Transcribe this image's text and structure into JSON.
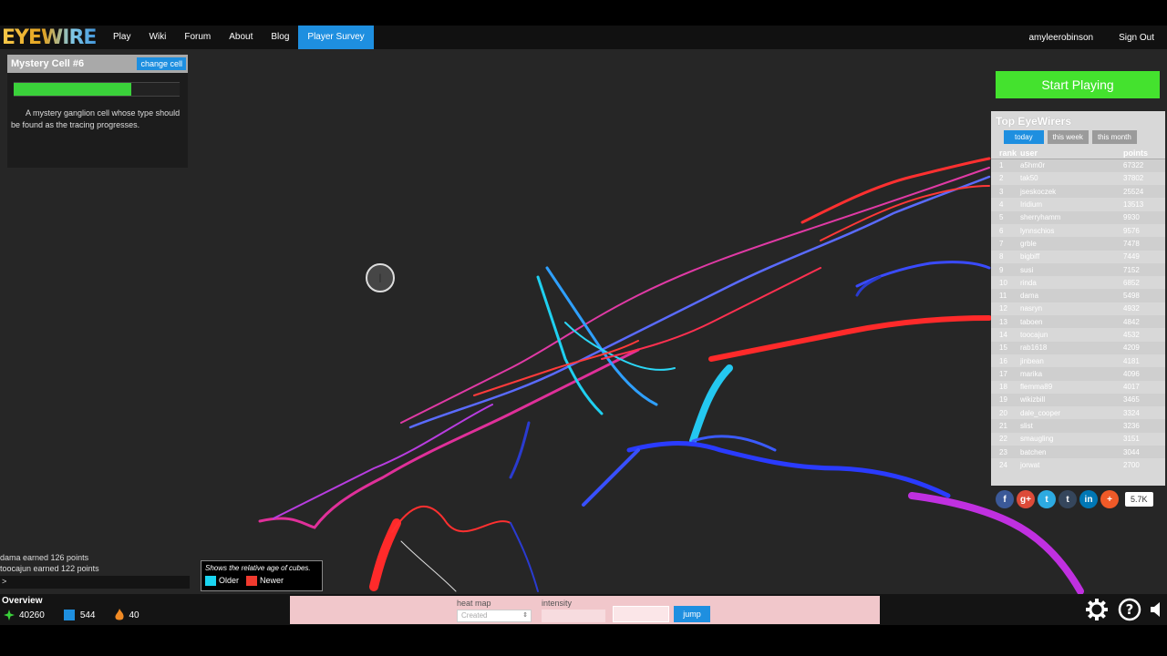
{
  "nav": {
    "logo": "EYEWIRE",
    "items": [
      "Play",
      "Wiki",
      "Forum",
      "About",
      "Blog",
      "Player Survey"
    ],
    "active_index": 5,
    "username": "amyleerobinson",
    "signout": "Sign Out"
  },
  "cell": {
    "title": "Mystery Cell #6",
    "change_label": "change cell",
    "progress_percent": 71,
    "description": "A mystery ganglion cell whose type should be found as the tracing progresses."
  },
  "start_label": "Start Playing",
  "leaderboard": {
    "title": "Top EyeWirers",
    "tabs": [
      "today",
      "this week",
      "this month"
    ],
    "active_tab": 0,
    "headers": [
      "rank",
      "user",
      "points"
    ],
    "rows": [
      {
        "rank": "1",
        "user": "a5hm0r",
        "points": "67322"
      },
      {
        "rank": "2",
        "user": "tak50",
        "points": "37802"
      },
      {
        "rank": "3",
        "user": "jseskoczek",
        "points": "25524"
      },
      {
        "rank": "4",
        "user": "Iridium",
        "points": "13513"
      },
      {
        "rank": "5",
        "user": "sherryhamm",
        "points": "9930"
      },
      {
        "rank": "6",
        "user": "lynnschios",
        "points": "9576"
      },
      {
        "rank": "7",
        "user": "grble",
        "points": "7478"
      },
      {
        "rank": "8",
        "user": "bigbiff",
        "points": "7449"
      },
      {
        "rank": "9",
        "user": "susi",
        "points": "7152"
      },
      {
        "rank": "10",
        "user": "rinda",
        "points": "6852"
      },
      {
        "rank": "11",
        "user": "dama",
        "points": "5498"
      },
      {
        "rank": "12",
        "user": "nasryn",
        "points": "4932"
      },
      {
        "rank": "13",
        "user": "taboen",
        "points": "4842"
      },
      {
        "rank": "14",
        "user": "toocajun",
        "points": "4532"
      },
      {
        "rank": "15",
        "user": "rab1618",
        "points": "4209"
      },
      {
        "rank": "16",
        "user": "jinbean",
        "points": "4181"
      },
      {
        "rank": "17",
        "user": "marika",
        "points": "4096"
      },
      {
        "rank": "18",
        "user": "flemma89",
        "points": "4017"
      },
      {
        "rank": "19",
        "user": "wikizbill",
        "points": "3465"
      },
      {
        "rank": "20",
        "user": "dale_cooper",
        "points": "3324"
      },
      {
        "rank": "21",
        "user": "slist",
        "points": "3236"
      },
      {
        "rank": "22",
        "user": "smaugling",
        "points": "3151"
      },
      {
        "rank": "23",
        "user": "batchen",
        "points": "3044"
      },
      {
        "rank": "24",
        "user": "jorwat",
        "points": "2700"
      }
    ]
  },
  "share": {
    "icons": [
      {
        "label": "f",
        "color": "#3b5998",
        "name": "facebook-icon"
      },
      {
        "label": "g+",
        "color": "#dd4b39",
        "name": "google-plus-icon"
      },
      {
        "label": "t",
        "color": "#2daae1",
        "name": "twitter-icon"
      },
      {
        "label": "t",
        "color": "#35465c",
        "name": "tumblr-icon"
      },
      {
        "label": "in",
        "color": "#0077b5",
        "name": "linkedin-icon"
      },
      {
        "label": "+",
        "color": "#f05a28",
        "name": "addthis-icon"
      }
    ],
    "count": "5.7K"
  },
  "chat": {
    "lines": [
      "dama earned 126 points",
      "toocajun earned 122 points"
    ],
    "prompt": ">"
  },
  "legend": {
    "caption": "Shows the relative age of cubes.",
    "older_label": "Older",
    "newer_label": "Newer",
    "older_color": "#19d4f0",
    "newer_color": "#f03a2e"
  },
  "bottom": {
    "overview": "Overview",
    "stat1": "40260",
    "stat2": "544",
    "stat3": "40",
    "heatmap_label": "heat map",
    "intensity_label": "intensity",
    "heatmap_value": "Created",
    "jump_label": "jump"
  }
}
